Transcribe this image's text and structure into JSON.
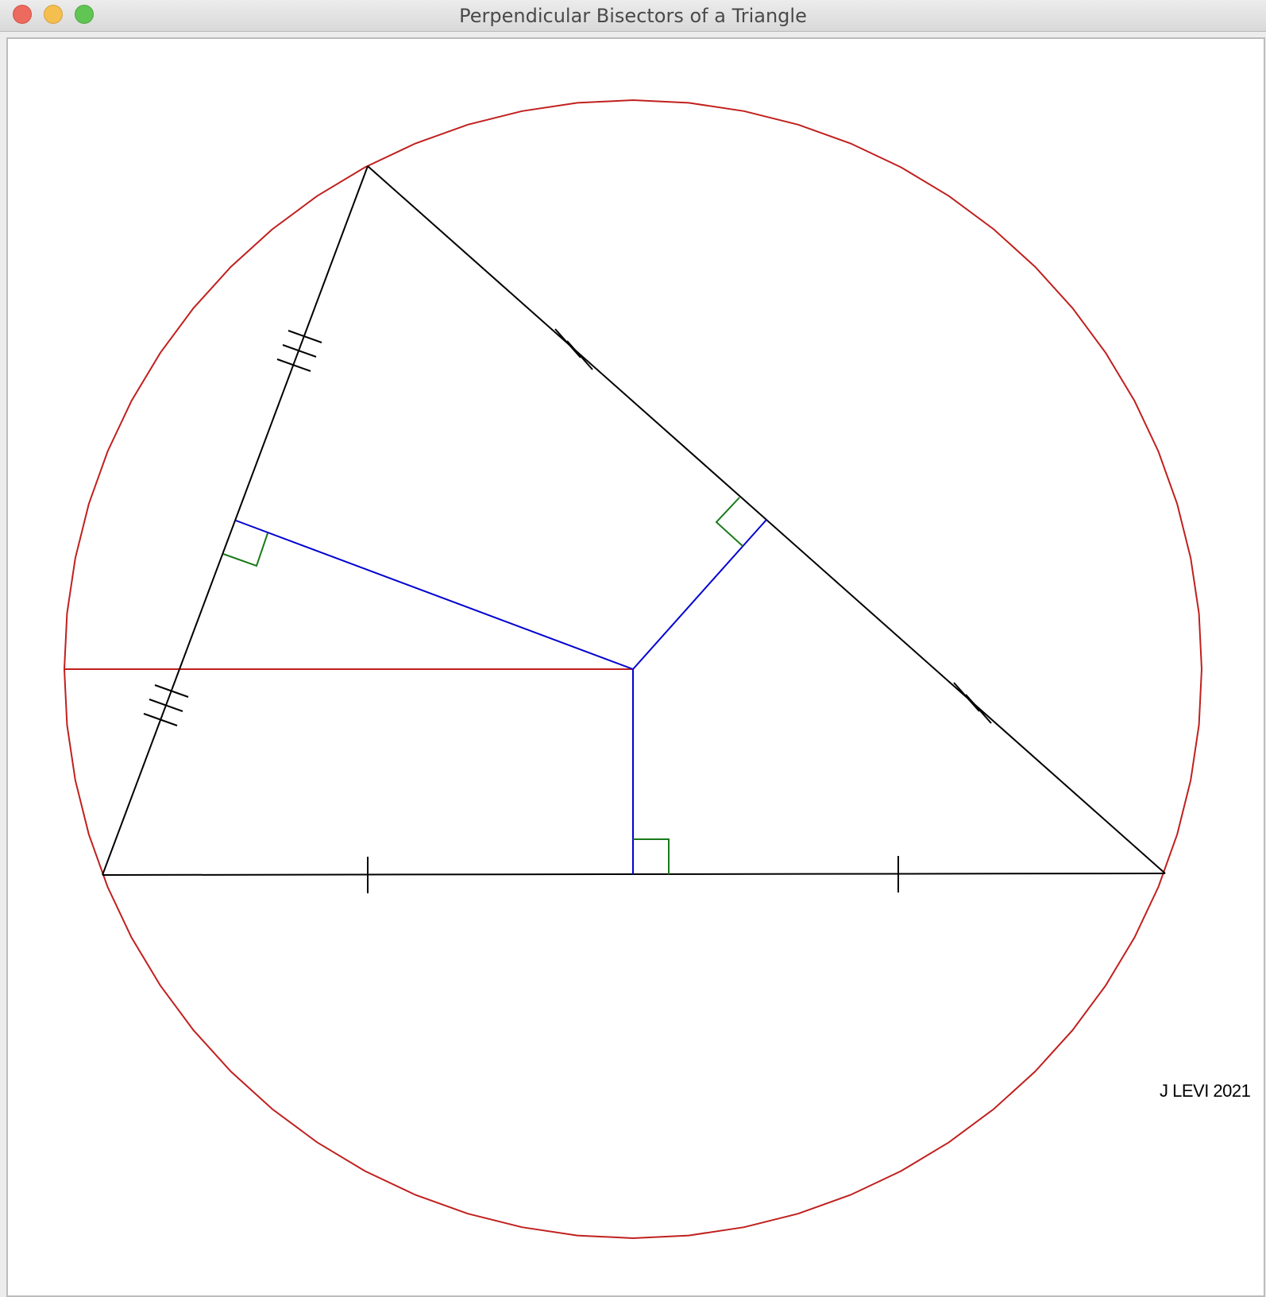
{
  "window": {
    "title": "Perpendicular Bisectors of a Triangle"
  },
  "canvas": {
    "credit": "J LEVI 2021"
  },
  "colors": {
    "circle": "#c0201e",
    "triangle": "#000000",
    "bisector": "#0000d0",
    "right_angle": "#1a7a1a",
    "tick": "#000000"
  },
  "icons": {
    "close": "close-button-icon",
    "minimize": "minimize-button-icon",
    "zoom": "zoom-button-icon"
  }
}
